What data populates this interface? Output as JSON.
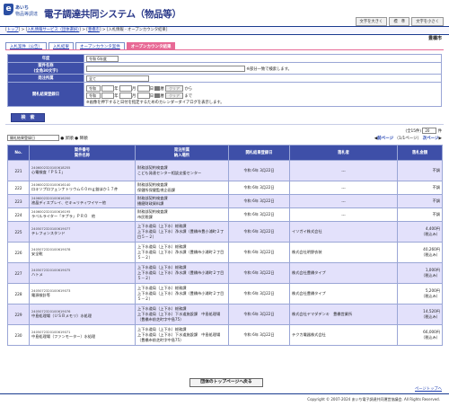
{
  "header": {
    "logo_mark": "e",
    "logo_line1": "あいち",
    "logo_line2": "物品等調達",
    "title": "電子調達共同システム（物品等）",
    "buttons": [
      "文字を大きく",
      "標　準",
      "文字を小さく"
    ]
  },
  "breadcrumb": {
    "items": [
      "トップ",
      "入札情報サービス（団体選択）",
      "豊橋市"
    ],
    "current": "入札情報 - オープンカウンタ結果"
  },
  "org_name": "豊橋市",
  "tabs": [
    "入札案件（公告）",
    "入札結果",
    "オープンカウンタ案件",
    "オープンカウンタ結果"
  ],
  "search": {
    "year_label": "年度",
    "year_value": "令和 6年度",
    "name_label": "案件名称",
    "name_label_sub": "(全角30文字)",
    "name_value": "",
    "name_note": "※部分一致で検索します。",
    "dept_label": "発注所属",
    "dept_value": "全て",
    "date_label": "開札結果登録日",
    "era": "令和",
    "y_unit": "年",
    "m_unit": "月",
    "d_unit": "日",
    "cal_label": "暦",
    "clear_label": "クリア",
    "from_text": "から",
    "to_text": "まで",
    "date_note": "※画像を押下すると日付を指定するためのカレンダーダイアログを表示します。",
    "submit_label": "検　索"
  },
  "list": {
    "sort_value": "開札結果登録日",
    "sort_asc": "昇順",
    "sort_desc": "降順",
    "count_text": "全15件",
    "per_page_value": "20",
    "count_unit": "件",
    "prev": "前ページ",
    "page_info": "（1/1ページ）",
    "next": "次ページ"
  },
  "table": {
    "headers": {
      "no": "No.",
      "case": "案件番号\n案件名称",
      "dept": "発注所属\n納入場所",
      "date": "開札結果登録日",
      "winner": "落札者",
      "amount": "落札金額"
    },
    "rows": [
      {
        "no": "221",
        "num": "2406002320100618255",
        "name": "心電検査「ＰＳＩ」",
        "dept": "財務部契約検査課",
        "place": "こども発達センター相談支援センター",
        "date": "令和 6年 3月22日",
        "winner": "---",
        "amount": "不調",
        "tax": ""
      },
      {
        "no": "222",
        "num": "2406002320100616140",
        "name": "ロキソプロフェンナトリウム６０ｍｇ錠ほか１７件",
        "dept": "財務部契約検査課",
        "place": "保健所保健監視企画課",
        "date": "令和 6年 3月22日",
        "winner": "---",
        "amount": "不調",
        "tax": ""
      },
      {
        "no": "223",
        "num": "2406002320100616200",
        "name": "液晶ディスプレイ、セキュリティワイヤー他",
        "dept": "財務部契約検査課",
        "place": "播磨財政資料課",
        "date": "令和 6年 3月22日",
        "winner": "---",
        "amount": "不調",
        "tax": ""
      },
      {
        "no": "224",
        "num": "2406002320100616195",
        "name": "ラベルライター「テプラ」ＰＲＯ　他",
        "dept": "財務部契約検査課",
        "place": "市民税課",
        "date": "令和 6年 3月22日",
        "winner": "---",
        "amount": "不調",
        "tax": ""
      },
      {
        "no": "225",
        "num": "2405072320100619077",
        "name": "テレフォンスタンド",
        "dept": "上下水道局（上下水）総務課",
        "place": "上下水道局（上下水）浄水課（豊橋市豊小浦町２丁目５－２）",
        "date": "令和 6年 3月22日",
        "winner": "イソガイ株式会社",
        "amount": "4,400円",
        "tax": "（税込み）"
      },
      {
        "no": "226",
        "num": "2405072320100619078",
        "name": "安全靴",
        "dept": "上下水道局（上下水）総務課",
        "place": "上下水道局（上下水）浄水課（豊橋市小浦町２丁目５－２）",
        "date": "令和 6年 3月22日",
        "winner": "株式会社明野衣装",
        "amount": "40,260円",
        "tax": "（税込み）"
      },
      {
        "no": "227",
        "num": "2405072320100619075",
        "name": "ハトメ",
        "dept": "上下水道局（上下水）総務課",
        "place": "上下水道局（上下水）浄水課（豊橋市小浦町２丁目５－２）",
        "date": "令和 6年 3月22日",
        "winner": "株式会社豊橋タイプ",
        "amount": "1,000円",
        "tax": "（税込み）"
      },
      {
        "no": "228",
        "num": "2405072320100619073",
        "name": "電源検針等",
        "dept": "上下水道局（上下水）総務課",
        "place": "上下水道局（上下水）浄水課（豊橋市小浦町２丁目５－２）",
        "date": "令和 6年 3月22日",
        "winner": "株式会社豊橋タイプ",
        "amount": "5,200円",
        "tax": "（税込み）"
      },
      {
        "no": "229",
        "num": "2405072320100619076",
        "name": "中島処理場（ＵＳＢメモリ）水処理",
        "dept": "上下水道局（上下水）総務課",
        "place": "上下水道局（上下水）下水道施設課　中島処理場（豊橋市前芝町字中島75）",
        "date": "令和 6年 3月22日",
        "winner": "株式会社ヤマダデンキ　豊橋営業所",
        "amount": "14,520円",
        "tax": "（税込み）"
      },
      {
        "no": "230",
        "num": "2405072320100619071",
        "name": "中島処理場（ファンモーター）水処理",
        "dept": "上下水道局（上下水）総務課",
        "place": "上下水道局（上下水）下水道施設課　中島処理場（豊橋市前芝町字中島75）",
        "date": "令和 6年 3月22日",
        "winner": "テクカ電器株式会社",
        "amount": "66,000円",
        "tax": "（税込み）"
      }
    ]
  },
  "footer": {
    "top_button": "団体のトップページへ戻る",
    "page_top": "ページトップへ",
    "copyright": "Copyright © 2007-2024 あいち電子調達共同運営協議会. All Rights Reserved."
  },
  "colors": {
    "header_blue": "#3e4fa8",
    "active_tab_pink": "#e86a96",
    "row_alt_lavender": "#e3e1fb"
  }
}
